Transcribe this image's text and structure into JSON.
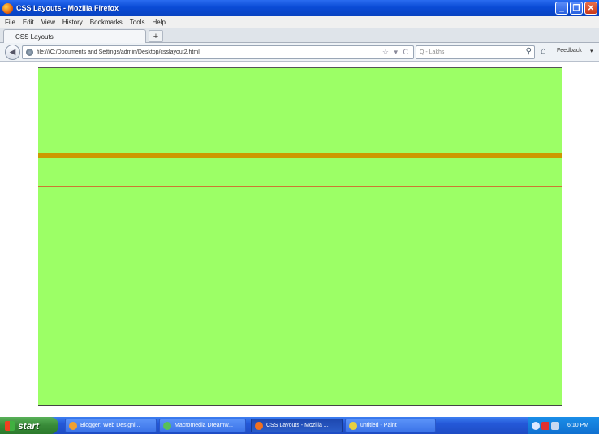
{
  "window": {
    "title": "CSS Layouts - Mozilla Firefox",
    "controls": {
      "minimize": "_",
      "maximize": "❐",
      "close": "✕"
    }
  },
  "menu": {
    "items": [
      "File",
      "Edit",
      "View",
      "History",
      "Bookmarks",
      "Tools",
      "Help"
    ]
  },
  "tabs": {
    "active_label": "CSS Layouts",
    "new_tab_label": "+"
  },
  "navigation": {
    "back_label": "◀",
    "url": "file:///C:/Documents and Settings/admin/Desktop/csslayout2.html",
    "url_tools": "☆ ▾ C",
    "search_placeholder": "Q - Lakhs",
    "search_icon": "⚲",
    "home_icon": "⌂",
    "feedback_label": "Feedback",
    "feedback_arrow": "▾"
  },
  "page": {
    "background_color": "#9cff66",
    "divider_color": "#cc9900",
    "line_color": "#cc7733"
  },
  "taskbar": {
    "start_label": "start",
    "tasks": [
      {
        "label": "Blogger: Web Designi...",
        "icon_color": "#f0a030"
      },
      {
        "label": "Macromedia Dreamw...",
        "icon_color": "#58c058"
      },
      {
        "label": "CSS Layouts - Mozilla ...",
        "icon_color": "#f07020"
      },
      {
        "label": "untitled - Paint",
        "icon_color": "#e8d040"
      }
    ],
    "clock": "6:10 PM"
  }
}
